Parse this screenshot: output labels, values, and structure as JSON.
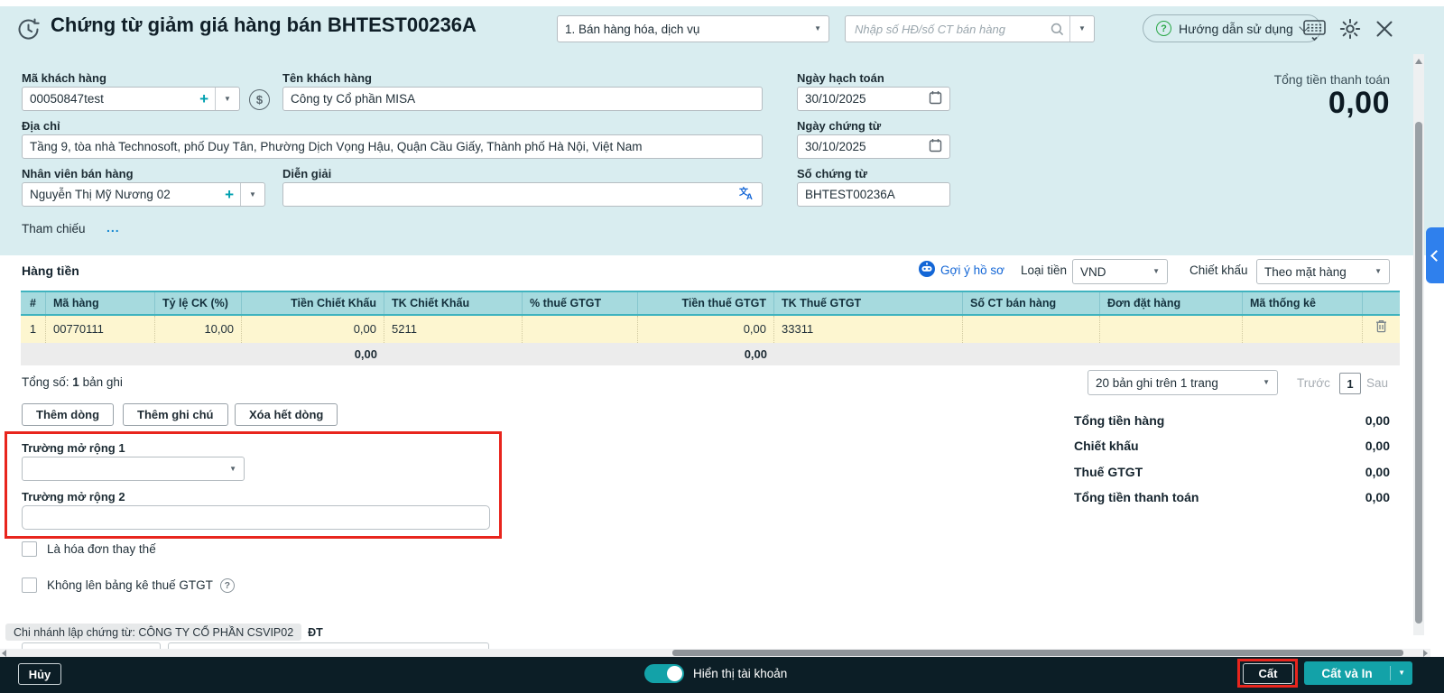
{
  "window": {
    "title": "Chứng từ giảm giá hàng bán BHTEST00236A",
    "voucher_type": "1. Bán hàng hóa, dịch vụ",
    "search_placeholder": "Nhập số HĐ/số CT bán hàng",
    "help_label": "Hướng dẫn sử dụng"
  },
  "form": {
    "customer_code": {
      "label": "Mã khách hàng",
      "value": "00050847test"
    },
    "customer_name": {
      "label": "Tên khách hàng",
      "value": "Công ty Cổ phần MISA"
    },
    "address": {
      "label": "Địa chỉ",
      "value": "Tầng 9, tòa nhà Technosoft, phố Duy Tân, Phường Dịch Vọng Hậu, Quận Cầu Giấy, Thành phố Hà Nội, Việt Nam"
    },
    "salesperson": {
      "label": "Nhân viên bán hàng",
      "value": "Nguyễn Thị Mỹ Nương 02"
    },
    "memo": {
      "label": "Diễn giải",
      "value": ""
    },
    "reference": {
      "label": "Tham chiếu",
      "more_link": "..."
    },
    "posting_date": {
      "label": "Ngày hạch toán",
      "value": "30/10/2025"
    },
    "voucher_date": {
      "label": "Ngày chứng từ",
      "value": "30/10/2025"
    },
    "voucher_no": {
      "label": "Số chứng từ",
      "value": "BHTEST00236A"
    },
    "grand_total": {
      "label": "Tổng tiền thanh toán",
      "value": "0,00"
    }
  },
  "items": {
    "section_title": "Hàng tiền",
    "suggest_link": "Gợi ý hồ sơ",
    "currency_label": "Loại tiền",
    "currency_value": "VND",
    "discount_label": "Chiết khấu",
    "discount_value": "Theo mặt hàng",
    "table": {
      "headers": [
        "#",
        "Mã hàng",
        "Tỷ lệ CK (%)",
        "Tiền Chiết Khấu",
        "TK Chiết Khấu",
        "% thuế GTGT",
        "Tiền thuế GTGT",
        "TK Thuế GTGT",
        "Số CT bán hàng",
        "Đơn đặt hàng",
        "Mã thống kê"
      ],
      "rows": [
        {
          "no": "1",
          "ma_hang": "00770111",
          "ty_le_ck": "10,00",
          "tien_chiet_khau": "0,00",
          "tk_chiet_khau": "5211",
          "pct_thue_gtgt": "",
          "tien_thue_gtgt": "0,00",
          "tk_thue_gtgt": "33311",
          "so_ct_ban_hang": "",
          "don_dat_hang": "",
          "ma_thong_ke": ""
        }
      ],
      "footer_totals": {
        "tien_chiet_khau": "0,00",
        "tien_thue_gtgt": "0,00"
      }
    },
    "record_summary": {
      "prefix": "Tổng số:",
      "count": "1",
      "suffix": "bản ghi"
    },
    "pagination": {
      "page_size": "20 bản ghi trên 1 trang",
      "prev": "Trước",
      "page": "1",
      "next": "Sau"
    },
    "row_buttons": [
      "Thêm dòng",
      "Thêm ghi chú",
      "Xóa hết dòng"
    ]
  },
  "extensions": {
    "field1_label": "Trường mở rộng 1",
    "field1_value": "",
    "field2_label": "Trường mở rộng 2",
    "field2_value": ""
  },
  "summary": [
    {
      "label": "Tổng tiền hàng",
      "value": "0,00"
    },
    {
      "label": "Chiết khấu",
      "value": "0,00"
    },
    {
      "label": "Thuế GTGT",
      "value": "0,00"
    },
    {
      "label": "Tổng tiền thanh toán",
      "value": "0,00"
    }
  ],
  "checkboxes": [
    {
      "label": "Là hóa đơn thay thế",
      "checked": false
    },
    {
      "label": "Không lên bảng kê thuế GTGT",
      "checked": false
    }
  ],
  "branch_note": {
    "text": "Chi nhánh lập chứng từ: CÔNG TY CỔ PHẦN CSVIP02",
    "suffix": "ĐT"
  },
  "footer": {
    "cancel": "Hủy",
    "toggle_label": "Hiển thị tài khoản",
    "toggle_on": true,
    "save": "Cất",
    "save_print": "Cất và In"
  },
  "colors": {
    "header_bg": "#d9edf0",
    "accent_teal": "#13a2a8",
    "table_header_bg": "#a6dade",
    "row_yellow": "#fdf6d0",
    "link_blue": "#1366d6",
    "annotation_red": "#e8251d",
    "footer_bg": "#0c1e26",
    "side_tab_blue": "#2f80ed"
  },
  "icons": {
    "caret_down": "▼",
    "question": "?",
    "dollar": "$"
  }
}
